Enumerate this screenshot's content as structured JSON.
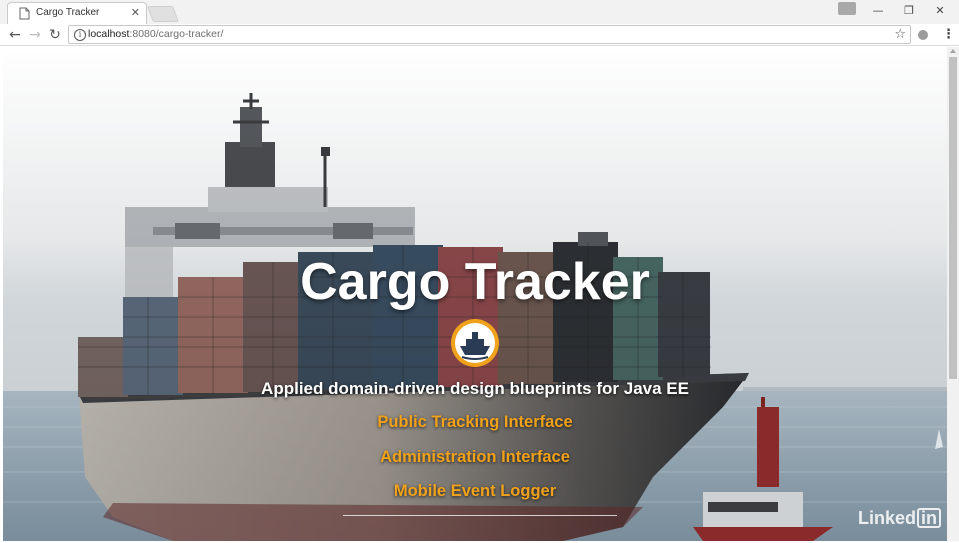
{
  "browser": {
    "tab_title": "Cargo Tracker",
    "tab_close_icon": "close-icon",
    "url_host": "localhost",
    "url_path": ":8080/cargo-tracker/",
    "window_controls": [
      "minimize-icon",
      "restore-icon",
      "close-icon"
    ]
  },
  "page": {
    "title": "Cargo Tracker",
    "subtitle": "Applied domain-driven design blueprints for Java EE",
    "links": [
      "Public Tracking Interface",
      "Administration Interface",
      "Mobile Event Logger"
    ],
    "logo_icon": "ship-logo-icon",
    "accent_color": "#f0a21c"
  },
  "watermark": {
    "text": "Linked",
    "box": "in"
  }
}
